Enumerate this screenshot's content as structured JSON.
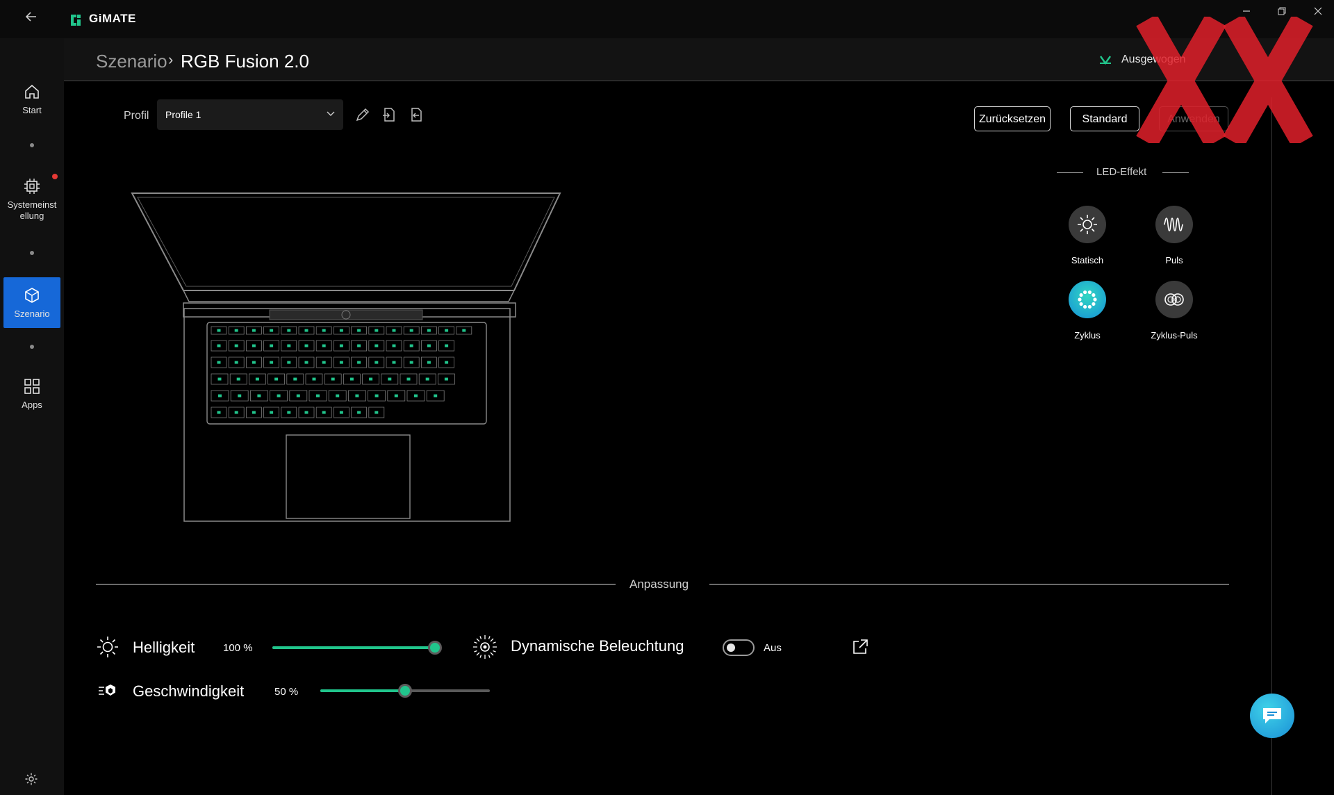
{
  "app": {
    "name": "GiMATE"
  },
  "colors": {
    "accent": "#1668d8",
    "slider": "#21c58c",
    "notification": "#e53935"
  },
  "sidebar": {
    "items": [
      {
        "label": "Start",
        "icon": "home-icon"
      },
      {
        "label": "Systemeinst ellung",
        "icon": "chip-icon",
        "notification": true
      },
      {
        "label": "Szenario",
        "icon": "cube-icon",
        "active": true
      },
      {
        "label": "Apps",
        "icon": "grid-icon"
      }
    ],
    "settings_icon": "gear-icon"
  },
  "header": {
    "breadcrumb_parent": "Szenario",
    "breadcrumb_separator": "›",
    "title": "RGB Fusion 2.0",
    "mode_label": "Ausgewogen"
  },
  "profile": {
    "label": "Profil",
    "selected": "Profile 1"
  },
  "buttons": {
    "reset": "Zurücksetzen",
    "default": "Standard",
    "apply": "Anwenden"
  },
  "led": {
    "title": "LED-Effekt",
    "effects": [
      {
        "label": "Statisch",
        "icon": "sun-icon"
      },
      {
        "label": "Puls",
        "icon": "wave-icon"
      },
      {
        "label": "Zyklus",
        "icon": "cycle-icon",
        "active": true
      },
      {
        "label": "Zyklus-Puls",
        "icon": "infinity-icon"
      }
    ]
  },
  "customization": {
    "title": "Anpassung",
    "brightness": {
      "label": "Helligkeit",
      "value_text": "100 %",
      "level": 1.0
    },
    "speed": {
      "label": "Geschwindigkeit",
      "value_text": "50 %",
      "level": 0.5
    },
    "dynamic": {
      "label": "Dynamische Beleuchtung",
      "state": "Aus"
    }
  }
}
